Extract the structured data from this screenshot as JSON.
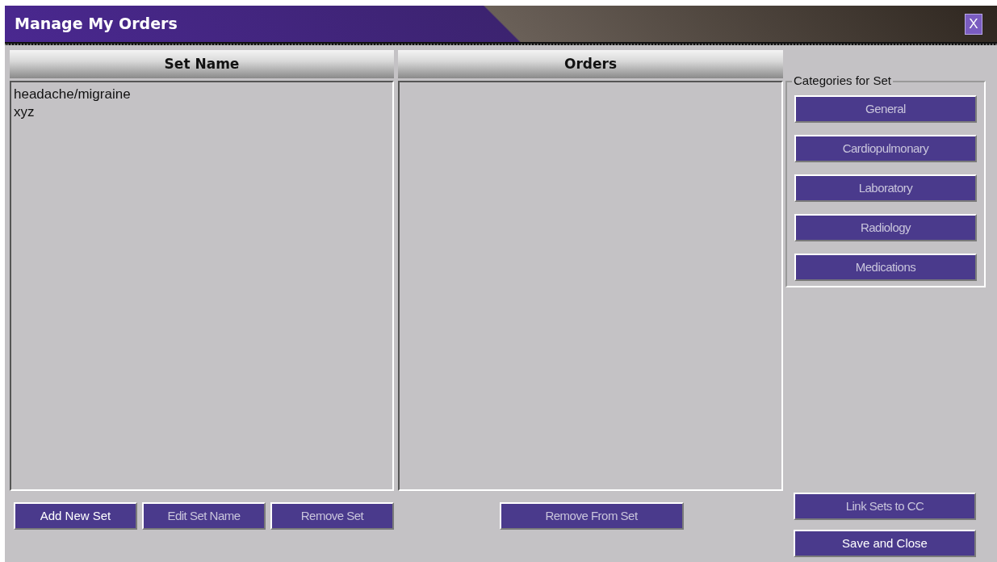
{
  "window": {
    "title": "Manage My Orders",
    "close_label": "X"
  },
  "set_panel": {
    "header": "Set Name",
    "items": [
      {
        "label": "headache/migraine",
        "selected": false
      },
      {
        "label": "xyz",
        "selected": false
      }
    ],
    "buttons": [
      {
        "label": "Add New Set",
        "disabled": false
      },
      {
        "label": "Edit Set Name",
        "disabled": true
      },
      {
        "label": "Remove Set",
        "disabled": true
      }
    ]
  },
  "orders_panel": {
    "header": "Orders",
    "buttons": [
      {
        "label": "Remove From Set",
        "disabled": true
      }
    ]
  },
  "categories": {
    "title": "Categories for Set",
    "buttons": [
      {
        "label": "General",
        "disabled": true
      },
      {
        "label": "Cardiopulmonary",
        "disabled": true
      },
      {
        "label": "Laboratory",
        "disabled": true
      },
      {
        "label": "Radiology",
        "disabled": true
      },
      {
        "label": "Medications",
        "disabled": true
      }
    ]
  },
  "side_buttons": [
    {
      "label": "Link Sets to CC",
      "disabled": true
    },
    {
      "label": "Save and Close",
      "disabled": false
    }
  ]
}
